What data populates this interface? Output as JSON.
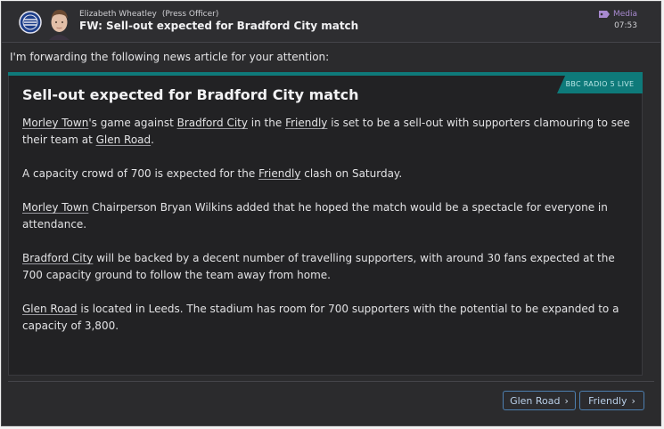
{
  "header": {
    "sender_name": "Elizabeth Wheatley",
    "sender_role": "(Press Officer)",
    "subject": "FW: Sell-out expected for Bradford City match",
    "category": "Media",
    "time": "07:53"
  },
  "intro": "I'm forwarding the following news article for your attention:",
  "article": {
    "source": "BBC RADIO 5 LIVE",
    "headline": "Sell-out expected for Bradford City match",
    "p1": {
      "link1": "Morley Town",
      "t1": "'s game against ",
      "link2": "Bradford City",
      "t2": " in the ",
      "link3": "Friendly",
      "t3": " is set to be a sell-out with supporters clamouring to see their team at ",
      "link4": "Glen Road",
      "t4": "."
    },
    "p2": {
      "t1": "A capacity crowd of 700 is expected for the ",
      "link1": "Friendly",
      "t2": " clash on Saturday."
    },
    "p3": {
      "link1": "Morley Town",
      "t1": " Chairperson Bryan Wilkins added that he hoped the match would be a spectacle for everyone in attendance."
    },
    "p4": {
      "link1": "Bradford City",
      "t1": " will be backed by a decent number of travelling supporters, with around 30 fans expected at the 700 capacity ground to follow the team away from home."
    },
    "p5": {
      "link1": "Glen Road",
      "t1": " is located in Leeds. The stadium has room for 700 supporters with the potential to be expanded to a capacity of 3,800."
    }
  },
  "actions": {
    "glen_road": "Glen Road",
    "friendly": "Friendly"
  },
  "colors": {
    "accent_teal": "#0e7a7a",
    "button_border": "#4d7fb0",
    "media_purple": "#a88ad0"
  }
}
